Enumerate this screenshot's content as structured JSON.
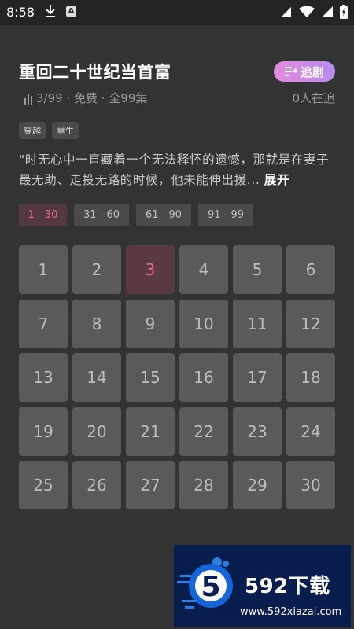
{
  "status_bar": {
    "time": "8:58"
  },
  "drama": {
    "title": "重回二十世纪当首富",
    "follow_label": "追剧",
    "meta": "3/99 · 免费 · 全99集",
    "online": "0人在追",
    "tags": [
      "穿越",
      "重生"
    ],
    "synopsis": "\"时无心中一直藏着一个无法释怀的遗憾，那就是在妻子最无助、走投无路的时候，他未能伸出援...",
    "expand_label": "展开"
  },
  "ranges": [
    {
      "label": "1 - 30",
      "active": true
    },
    {
      "label": "31 - 60",
      "active": false
    },
    {
      "label": "61 - 90",
      "active": false
    },
    {
      "label": "91 - 99",
      "active": false
    }
  ],
  "episodes": [
    "1",
    "2",
    "3",
    "4",
    "5",
    "6",
    "7",
    "8",
    "9",
    "10",
    "11",
    "12",
    "13",
    "14",
    "15",
    "16",
    "17",
    "18",
    "19",
    "20",
    "21",
    "22",
    "23",
    "24",
    "25",
    "26",
    "27",
    "28",
    "29",
    "30"
  ],
  "current_episode": "3",
  "watermark": {
    "brand": "592下载",
    "url": "www.592xiazai.com",
    "badge_digit": "5"
  },
  "colors": {
    "accent_pink": "#ea6a8a",
    "follow_gradient_start": "#e58be0",
    "follow_gradient_end": "#b58af0",
    "watermark_bg": "#071d4e"
  }
}
